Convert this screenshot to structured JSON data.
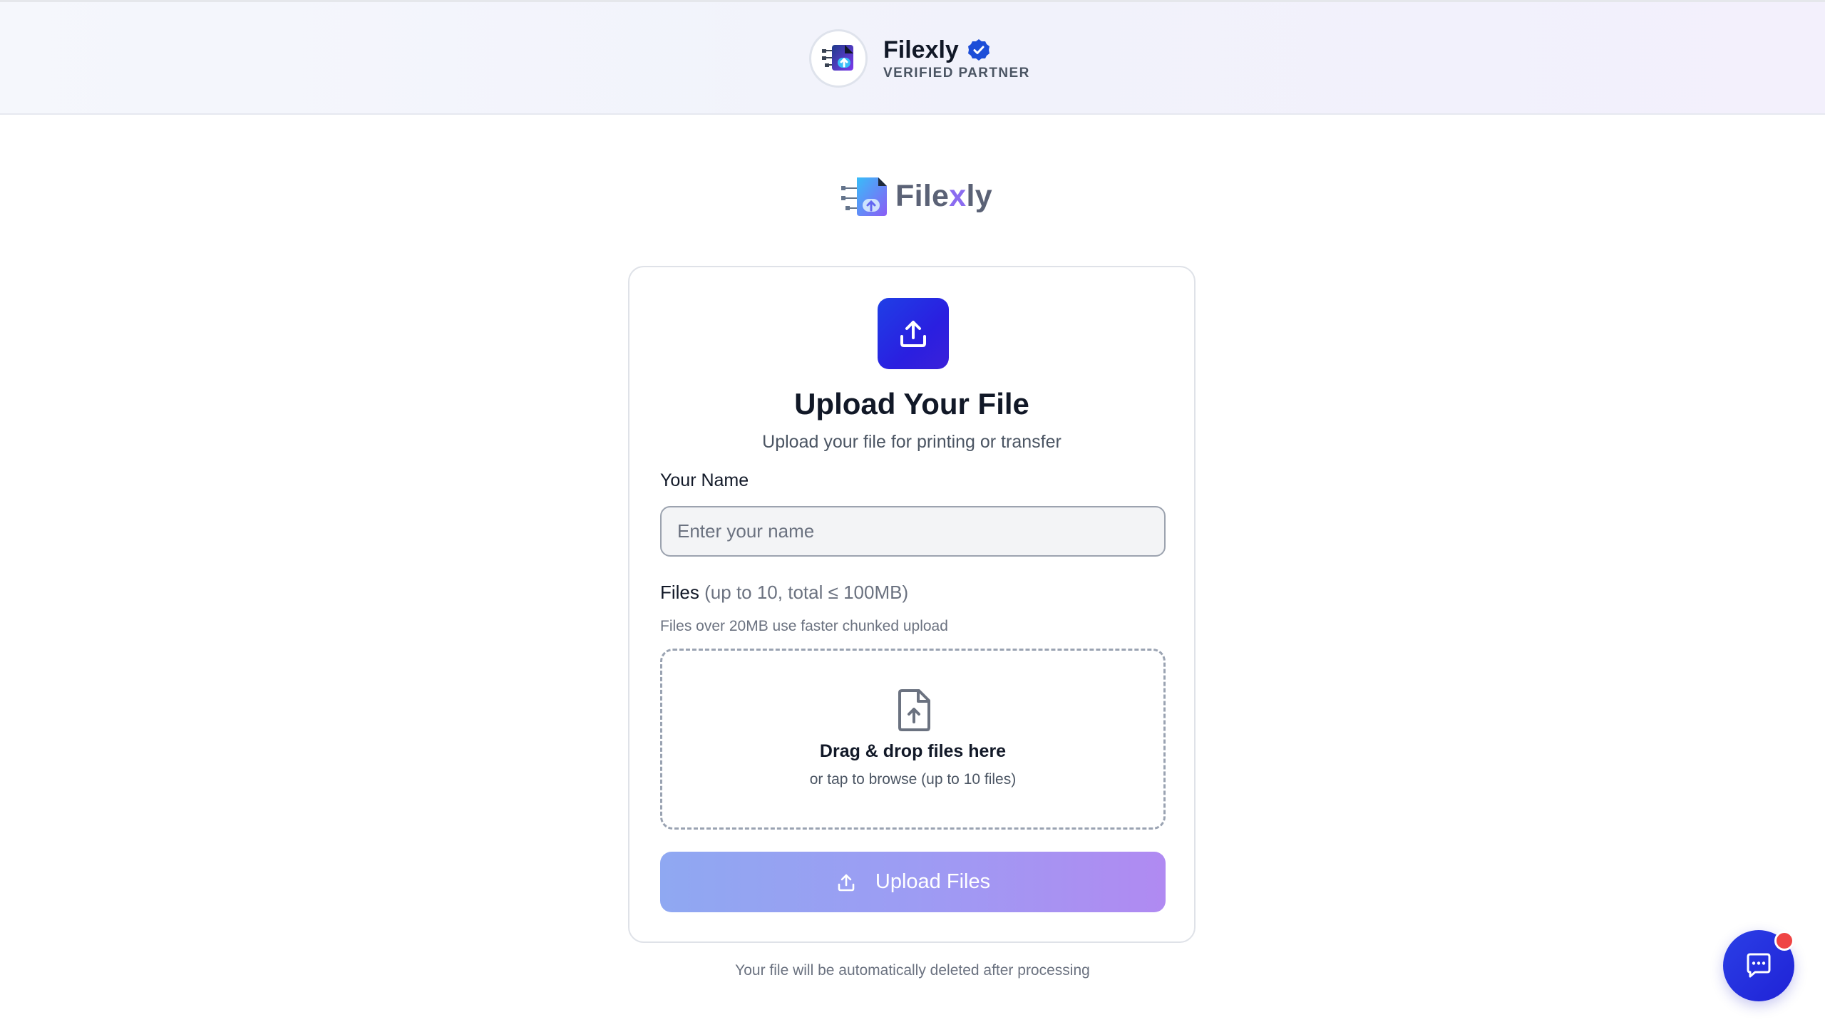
{
  "header": {
    "partner_name": "Filexly",
    "partner_badge": "VERIFIED PARTNER",
    "verified_icon": "verified-check-icon"
  },
  "brand": {
    "name_prefix": "File",
    "name_x": "x",
    "name_suffix": "ly"
  },
  "card": {
    "icon": "upload-icon",
    "title": "Upload Your File",
    "subtitle": "Upload your file for printing or transfer",
    "name_label": "Your Name",
    "name_placeholder": "Enter your name",
    "name_value": "",
    "files_label": "Files",
    "files_hint": "(up to 10, total ≤ 100MB)",
    "files_note": "Files over 20MB use faster chunked upload",
    "dropzone": {
      "icon": "file-upload-icon",
      "title": "Drag & drop files here",
      "subtitle": "or tap to browse (up to 10 files)"
    },
    "upload_button_label": "Upload Files"
  },
  "footer": {
    "note": "Your file will be automatically deleted after processing"
  },
  "chat": {
    "icon": "chat-bubble-icon",
    "has_notification": true
  },
  "colors": {
    "accent": "#1f3fe6",
    "button_gradient_start": "#8fa8f2",
    "button_gradient_end": "#b08af2",
    "verified": "#1d4ed8",
    "notification": "#ef4444"
  }
}
